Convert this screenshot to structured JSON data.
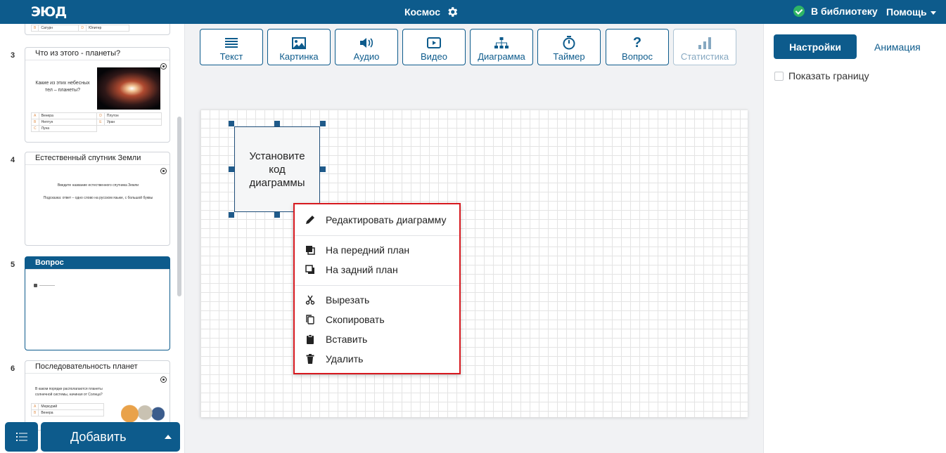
{
  "header": {
    "logo": "ЭЮД",
    "title": "Космос",
    "library": "В библиотеку",
    "help": "Помощь"
  },
  "slides": [
    {
      "num": "3",
      "title": "Что из этого - планеты?",
      "question": "Какие из этих небесных тел – планеты?",
      "options": [
        {
          "letter": "A",
          "text": "Венера"
        },
        {
          "letter": "D",
          "text": "Плутон"
        },
        {
          "letter": "B",
          "text": "Нептун"
        },
        {
          "letter": "E",
          "text": "Уран"
        },
        {
          "letter": "C",
          "text": "Луна"
        }
      ]
    },
    {
      "num": "4",
      "title": "Естественный спутник Земли",
      "line1": "Введите название естественного спутника Земли",
      "line2": "Подсказка: ответ – одно слово на русском языке, с большой буквы"
    },
    {
      "num": "5",
      "title": "Вопрос"
    },
    {
      "num": "6",
      "title": "Последовательность планет",
      "question": "В каком порядке располагаются планеты солнечной системы, начиная от Солнца?",
      "options": [
        {
          "letter": "A",
          "text": "Меркурий"
        },
        {
          "letter": "B",
          "text": "Венера"
        }
      ]
    }
  ],
  "top_partial": {
    "letter1": "B",
    "text1": "Сатурн",
    "letter2": "D",
    "text2": "Юпитер"
  },
  "add_button": "Добавить",
  "toolbar": {
    "text": "Текст",
    "image": "Картинка",
    "audio": "Аудио",
    "video": "Видео",
    "diagram": "Диаграмма",
    "timer": "Таймер",
    "question": "Вопрос",
    "stats": "Статистика"
  },
  "canvas": {
    "shape_text": "Установите код диаграммы"
  },
  "context_menu": {
    "edit": "Редактировать диаграмму",
    "front": "На передний план",
    "back": "На задний план",
    "cut": "Вырезать",
    "copy": "Скопировать",
    "paste": "Вставить",
    "delete": "Удалить"
  },
  "right_panel": {
    "settings_tab": "Настройки",
    "animation_tab": "Анимация",
    "show_border": "Показать границу"
  },
  "colors": {
    "primary": "#0d5b8c",
    "menu_border": "#d7191f",
    "success": "#2fb565"
  }
}
